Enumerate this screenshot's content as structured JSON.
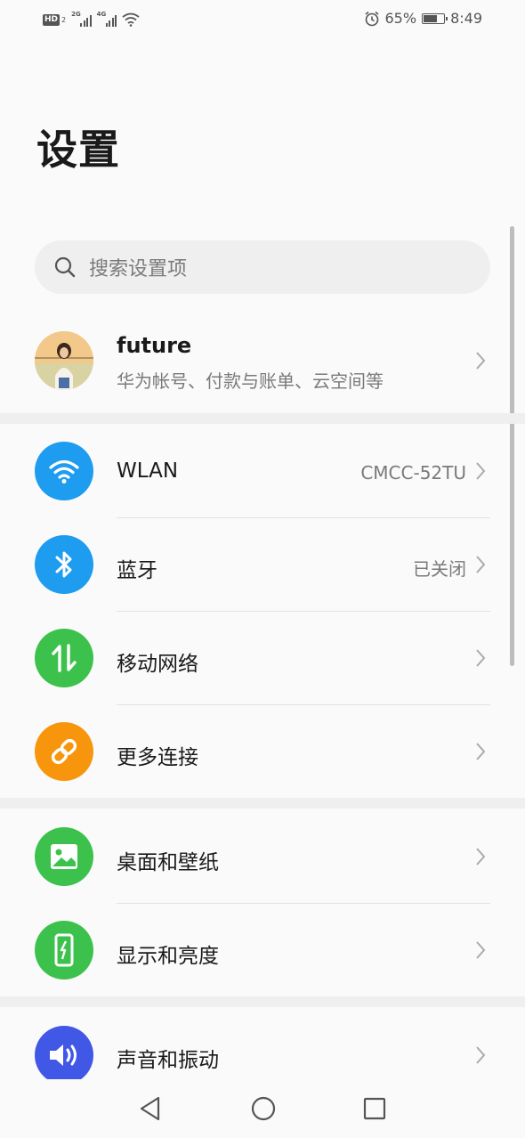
{
  "status_bar": {
    "hd_label": "HD",
    "hd_sub": "2",
    "net1": "2G",
    "net2": "4G",
    "battery_percent": "65%",
    "time": "8:49",
    "icons": [
      "hd-icon",
      "signal-icon",
      "signal-icon",
      "wifi-icon",
      "alarm-icon",
      "battery-icon"
    ]
  },
  "page": {
    "title": "设置"
  },
  "search": {
    "placeholder": "搜索设置项",
    "icon": "search-icon"
  },
  "account": {
    "name": "future",
    "subtitle": "华为帐号、付款与账单、云空间等"
  },
  "groups": [
    {
      "items": [
        {
          "label": "WLAN",
          "value": "CMCC-52TU",
          "icon": "wifi-icon",
          "color": "#1e9cf0"
        },
        {
          "label": "蓝牙",
          "value": "已关闭",
          "icon": "bluetooth-icon",
          "color": "#1e9cf0"
        },
        {
          "label": "移动网络",
          "value": "",
          "icon": "mobile-data-icon",
          "color": "#3cc24c"
        },
        {
          "label": "更多连接",
          "value": "",
          "icon": "link-icon",
          "color": "#f7960d"
        }
      ]
    },
    {
      "items": [
        {
          "label": "桌面和壁纸",
          "icon": "wallpaper-icon",
          "color": "#3cc24c"
        },
        {
          "label": "显示和亮度",
          "icon": "display-icon",
          "color": "#3cc24c"
        }
      ]
    },
    {
      "items": [
        {
          "label": "声音和振动",
          "icon": "sound-icon",
          "color": "#4157e6"
        }
      ]
    }
  ],
  "navbar": {
    "buttons": [
      "back-icon",
      "home-icon",
      "recents-icon"
    ]
  }
}
